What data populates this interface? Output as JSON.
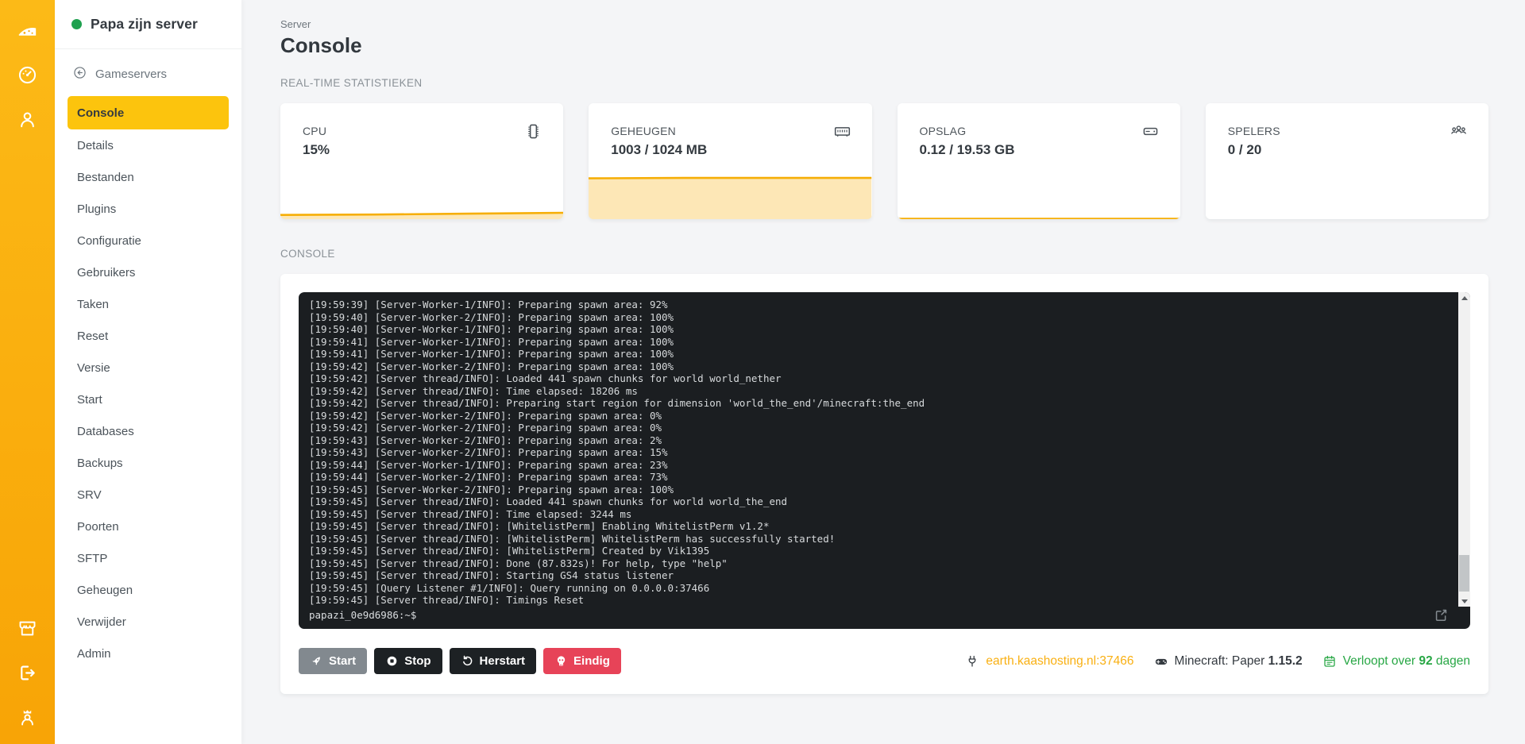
{
  "colors": {
    "accent": "#f9b013",
    "accent_bright": "#fcc40d",
    "green": "#28a745",
    "danger": "#e74358",
    "dark": "#1d2124",
    "terminal_bg": "#1b1e21"
  },
  "rail": {
    "top_icons": [
      "cheese-logo-icon",
      "dashboard-icon",
      "account-icon"
    ],
    "bottom_icons": [
      "shop-icon",
      "logout-icon",
      "admin-users-icon"
    ]
  },
  "sidebar": {
    "status_dot_color": "#1fa14f",
    "server_name": "Papa zijn server",
    "back_label": "Gameservers",
    "items": [
      {
        "label": "Console",
        "active": true
      },
      {
        "label": "Details",
        "active": false
      },
      {
        "label": "Bestanden",
        "active": false
      },
      {
        "label": "Plugins",
        "active": false
      },
      {
        "label": "Configuratie",
        "active": false
      },
      {
        "label": "Gebruikers",
        "active": false
      },
      {
        "label": "Taken",
        "active": false
      },
      {
        "label": "Reset",
        "active": false
      },
      {
        "label": "Versie",
        "active": false
      },
      {
        "label": "Start",
        "active": false
      },
      {
        "label": "Databases",
        "active": false
      },
      {
        "label": "Backups",
        "active": false
      },
      {
        "label": "SRV",
        "active": false
      },
      {
        "label": "Poorten",
        "active": false
      },
      {
        "label": "SFTP",
        "active": false
      },
      {
        "label": "Geheugen",
        "active": false
      },
      {
        "label": "Verwijder",
        "active": false
      },
      {
        "label": "Admin",
        "active": false
      }
    ]
  },
  "header": {
    "kicker": "Server",
    "title": "Console"
  },
  "stats_section": {
    "label": "REAL-TIME STATISTIEKEN",
    "cards": [
      {
        "label": "CPU",
        "value": "15%",
        "icon": "cpu-chip-icon",
        "spark_history": [
          10,
          11,
          13,
          15
        ]
      },
      {
        "label": "GEHEUGEN",
        "value": "1003 / 1024 MB",
        "icon": "memory-icon",
        "spark_history": [
          97,
          98,
          98,
          98
        ]
      },
      {
        "label": "OPSLAG",
        "value": "0.12 / 19.53 GB",
        "icon": "disk-icon",
        "spark_history": [
          1,
          1,
          1,
          1
        ]
      },
      {
        "label": "SPELERS",
        "value": "0 / 20",
        "icon": "players-icon",
        "spark_history": [
          0,
          0,
          0,
          0
        ]
      }
    ]
  },
  "console_section": {
    "label": "CONSOLE",
    "terminal_lines": [
      "[19:59:39] [Server-Worker-1/INFO]: Preparing spawn area: 92%",
      "[19:59:40] [Server-Worker-2/INFO]: Preparing spawn area: 100%",
      "[19:59:40] [Server-Worker-1/INFO]: Preparing spawn area: 100%",
      "[19:59:41] [Server-Worker-1/INFO]: Preparing spawn area: 100%",
      "[19:59:41] [Server-Worker-1/INFO]: Preparing spawn area: 100%",
      "[19:59:42] [Server-Worker-2/INFO]: Preparing spawn area: 100%",
      "[19:59:42] [Server thread/INFO]: Loaded 441 spawn chunks for world world_nether",
      "[19:59:42] [Server thread/INFO]: Time elapsed: 18206 ms",
      "[19:59:42] [Server thread/INFO]: Preparing start region for dimension 'world_the_end'/minecraft:the_end",
      "[19:59:42] [Server-Worker-2/INFO]: Preparing spawn area: 0%",
      "[19:59:42] [Server-Worker-2/INFO]: Preparing spawn area: 0%",
      "[19:59:43] [Server-Worker-2/INFO]: Preparing spawn area: 2%",
      "[19:59:43] [Server-Worker-2/INFO]: Preparing spawn area: 15%",
      "[19:59:44] [Server-Worker-1/INFO]: Preparing spawn area: 23%",
      "[19:59:44] [Server-Worker-2/INFO]: Preparing spawn area: 73%",
      "[19:59:45] [Server-Worker-2/INFO]: Preparing spawn area: 100%",
      "[19:59:45] [Server thread/INFO]: Loaded 441 spawn chunks for world world_the_end",
      "[19:59:45] [Server thread/INFO]: Time elapsed: 3244 ms",
      "[19:59:45] [Server thread/INFO]: [WhitelistPerm] Enabling WhitelistPerm v1.2*",
      "[19:59:45] [Server thread/INFO]: [WhitelistPerm] WhitelistPerm has successfully started!",
      "[19:59:45] [Server thread/INFO]: [WhitelistPerm] Created by Vik1395",
      "[19:59:45] [Server thread/INFO]: Done (87.832s)! For help, type \"help\"",
      "[19:59:45] [Server thread/INFO]: Starting GS4 status listener",
      "[19:59:45] [Query Listener #1/INFO]: Query running on 0.0.0.0:37466",
      "[19:59:45] [Server thread/INFO]: Timings Reset"
    ],
    "prompt": "papazi_0e9d6986:~$"
  },
  "actions": [
    {
      "label": "Start",
      "style": "secondary",
      "icon": "rocket-icon"
    },
    {
      "label": "Stop",
      "style": "dark",
      "icon": "stop-circle-icon"
    },
    {
      "label": "Herstart",
      "style": "dark",
      "icon": "restart-icon"
    },
    {
      "label": "Eindig",
      "style": "danger",
      "icon": "skull-icon"
    }
  ],
  "status_bar": [
    {
      "icon": "plug-icon",
      "pre": "earth.kaashosting.nl:37466",
      "strong": "",
      "post": "",
      "color": "#f9b013",
      "link": true
    },
    {
      "icon": "gamepad-icon",
      "pre": "Minecraft: Paper ",
      "strong": "1.15.2",
      "post": "",
      "color": "#343a40",
      "link": false
    },
    {
      "icon": "calendar-icon",
      "pre": "Verloopt over ",
      "strong": "92",
      "post": " dagen",
      "color": "#28a745",
      "link": false
    }
  ]
}
